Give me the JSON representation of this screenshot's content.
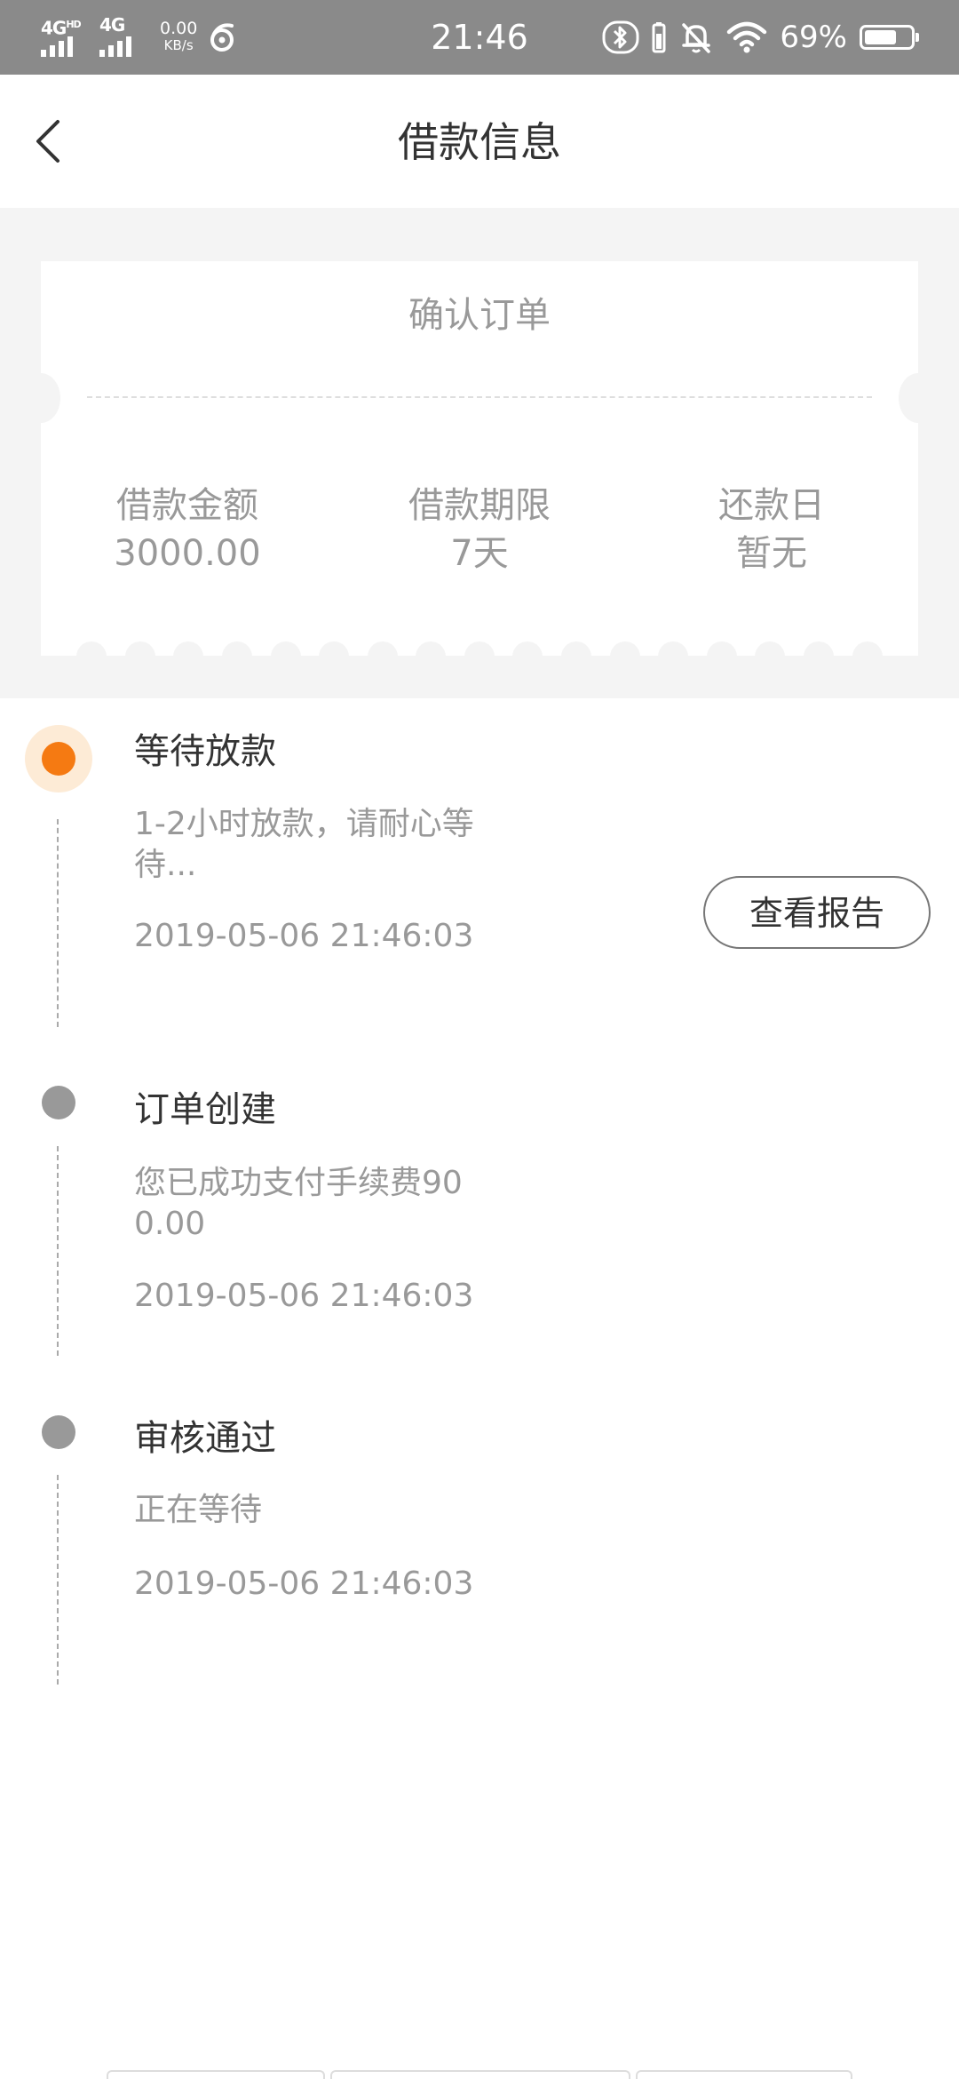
{
  "status_bar": {
    "sim1": "4G",
    "sim1_badge": "HD",
    "sim2": "4G",
    "speed_value": "0.00",
    "speed_unit": "KB/s",
    "time": "21:46",
    "battery_percent": "69%",
    "battery_level": 0.69
  },
  "header": {
    "title": "借款信息"
  },
  "ticket": {
    "title": "确认订单",
    "items": [
      {
        "label": "借款金额",
        "value": "3000.00"
      },
      {
        "label": "借款期限",
        "value": "7天"
      },
      {
        "label": "还款日",
        "value": "暂无"
      }
    ]
  },
  "timeline": [
    {
      "title": "等待放款",
      "desc": "1-2小时放款，请耐心等待...",
      "time": "2019-05-06 21:46:03",
      "status": "active",
      "button": "查看报告"
    },
    {
      "title": "订单创建",
      "desc": "您已成功支付手续费900.00",
      "time": "2019-05-06 21:46:03",
      "status": "done"
    },
    {
      "title": "审核通过",
      "desc": "正在等待",
      "time": "2019-05-06 21:46:03",
      "status": "done"
    }
  ],
  "colors": {
    "accent": "#f57a12",
    "accent_light": "#fdebd6",
    "status_bar": "#8a8a8a",
    "gray_bg": "#f4f4f4",
    "text_primary": "#333333",
    "text_secondary": "#999999"
  }
}
